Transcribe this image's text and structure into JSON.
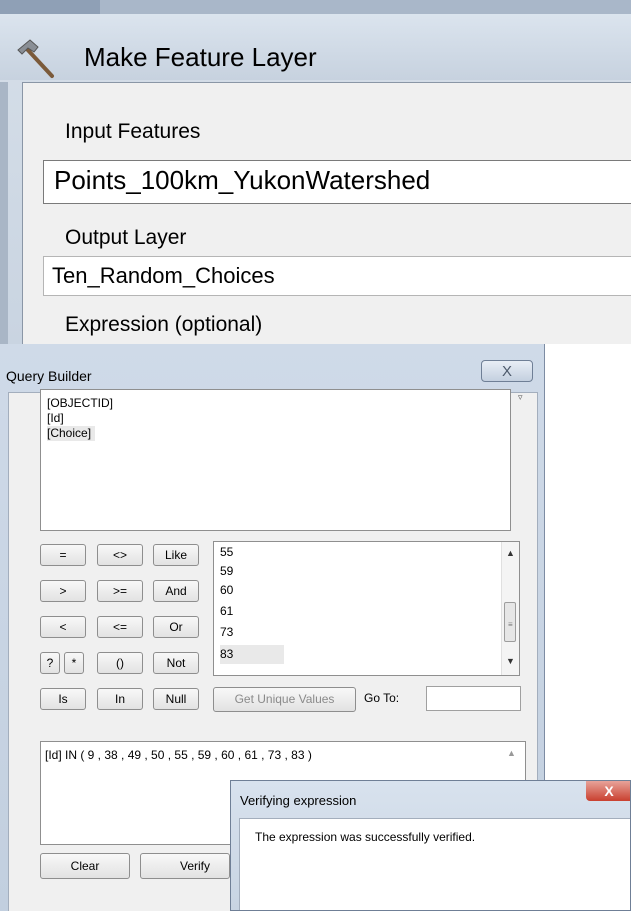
{
  "make_feature_layer": {
    "title": "Make Feature Layer",
    "title_icon": "hammer-icon",
    "input_features_label": "Input Features",
    "input_features_value": "Points_100km_YukonWatershed",
    "output_layer_label": "Output Layer",
    "output_layer_value": "Ten_Random_Choices",
    "expression_label": "Expression (optional)"
  },
  "query_builder": {
    "title": "Query Builder",
    "close_glyph": "X",
    "fields": [
      "[OBJECTID]",
      "[Id]",
      "[Choice]"
    ],
    "selected_field": "[Choice]",
    "operators": {
      "eq": "=",
      "ne": "<>",
      "like": "Like",
      "gt": ">",
      "ge": ">=",
      "and": "And",
      "lt": "<",
      "le": "<=",
      "or": "Or",
      "q": "?",
      "star": "*",
      "parens": "()",
      "not": "Not",
      "is": "Is",
      "in": "In",
      "null": "Null"
    },
    "unique_values": [
      "55",
      "59",
      "60",
      "61",
      "73",
      "83"
    ],
    "selected_value": "83",
    "get_unique_values_label": "Get Unique Values",
    "go_to_label": "Go To:",
    "go_to_value": "",
    "expression": "[Id] IN ( 9 , 38 , 49 , 50 , 55 , 59 , 60 , 61 , 73 , 83 )",
    "clear_label": "Clear",
    "verify_label": "Verify"
  },
  "verifying_dialog": {
    "title": "Verifying expression",
    "close_glyph": "X",
    "message": "The expression was successfully verified."
  },
  "colors": {
    "window_frame": "#c9d4e1",
    "dialog_face": "#f0f0f0",
    "close_red": "#c9402f"
  }
}
